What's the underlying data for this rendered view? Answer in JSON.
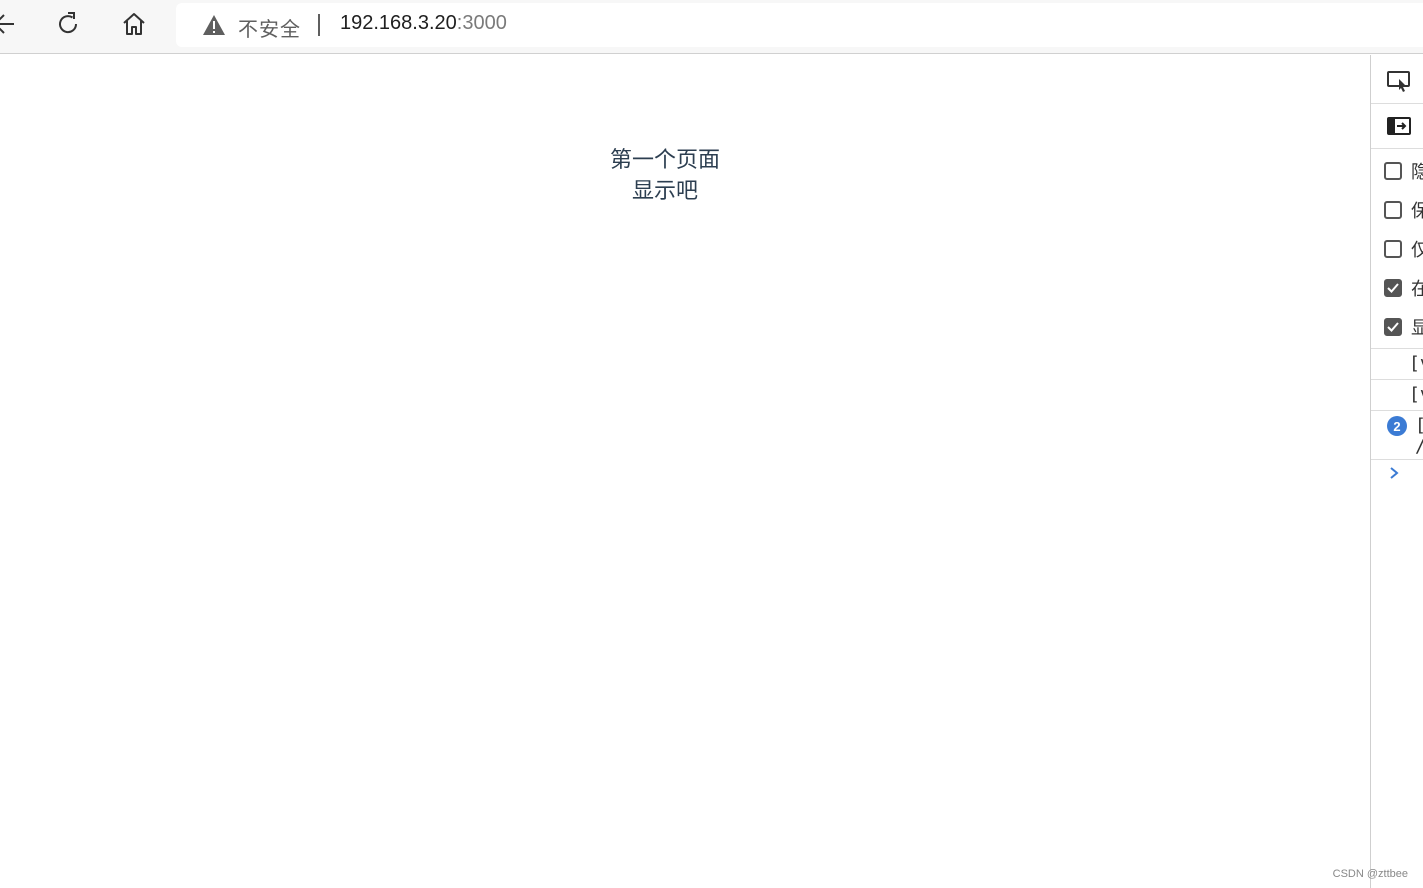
{
  "browser": {
    "back_icon": "back-arrow-icon",
    "refresh_icon": "refresh-icon",
    "home_icon": "home-icon",
    "security_label": "不安全",
    "url_host": "192.168.3.20",
    "url_port": ":3000",
    "edge_glyph": "/"
  },
  "page": {
    "line1": "第一个页面",
    "line2": "显示吧"
  },
  "devtools": {
    "checkboxes": [
      {
        "label": "隐",
        "checked": false
      },
      {
        "label": "保",
        "checked": false
      },
      {
        "label": "仅",
        "checked": false
      },
      {
        "label": "在",
        "checked": true
      },
      {
        "label": "显",
        "checked": true
      }
    ],
    "logs": [
      {
        "text": "[v"
      },
      {
        "text": "[v"
      }
    ],
    "grouped_log": {
      "count": "2",
      "line1": "[",
      "line2": "/"
    }
  },
  "watermark": "CSDN @zttbee",
  "colors": {
    "page_text": "#2c3e50",
    "badge": "#3b7bd4",
    "chevron": "#3b7bd4"
  }
}
